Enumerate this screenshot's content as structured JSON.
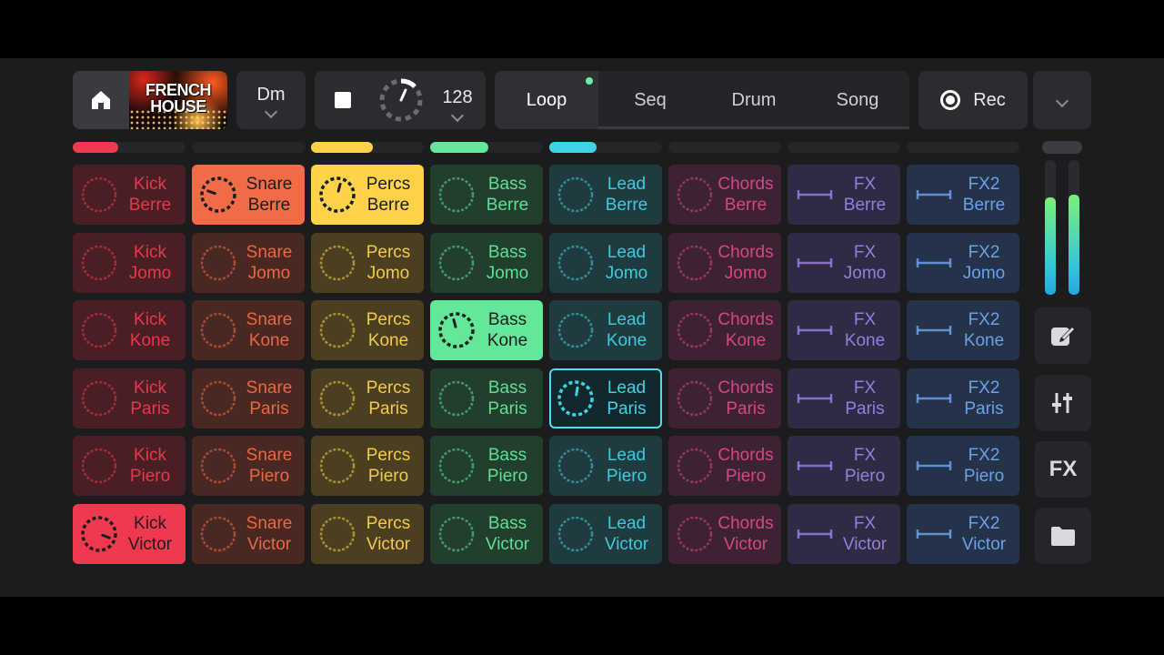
{
  "project": {
    "cover_title": "FRENCH\nHOUSE",
    "key": "Dm",
    "tempo": "128"
  },
  "icons": {
    "home": "home-icon",
    "stop": "stop-icon",
    "tempo_knob": "tempo-knob-icon",
    "record": "record-icon",
    "more": "chevron-down-icon",
    "edit": "edit-icon",
    "mixer": "mixer-sliders-icon",
    "folder": "folder-icon"
  },
  "tabs": [
    {
      "label": "Loop",
      "active": true
    },
    {
      "label": "Seq",
      "active": false
    },
    {
      "label": "Drum",
      "active": false
    },
    {
      "label": "Song",
      "active": false
    }
  ],
  "record": {
    "label": "Rec"
  },
  "sidebar": {
    "fx_label": "FX"
  },
  "levels": {
    "left": 0.72,
    "right": 0.74
  },
  "column_activity": [
    0.4,
    0,
    0.55,
    0.52,
    0.42,
    0,
    0,
    0
  ],
  "tracks": [
    {
      "name": "Kick",
      "color": "#f0394f",
      "tint": "#4a1f24",
      "active_row": 5,
      "type": "loop"
    },
    {
      "name": "Snare",
      "color": "#f26b47",
      "tint": "#4a2822",
      "active_row": 0,
      "type": "loop"
    },
    {
      "name": "Percs",
      "color": "#ffd24a",
      "tint": "#4a4021",
      "active_row": 0,
      "type": "loop"
    },
    {
      "name": "Bass",
      "color": "#63e79a",
      "tint": "#213f2c",
      "active_row": 2,
      "type": "loop"
    },
    {
      "name": "Lead",
      "color": "#3fd3e6",
      "tint": "#1f3b3f",
      "active_row": -1,
      "armed_row": 3,
      "type": "loop"
    },
    {
      "name": "Chords",
      "color": "#e0478e",
      "tint": "#3c2233",
      "active_row": -1,
      "type": "loop"
    },
    {
      "name": "FX",
      "color": "#9b82e6",
      "tint": "#302b45",
      "active_row": -1,
      "type": "fx"
    },
    {
      "name": "FX2",
      "color": "#6fa7f2",
      "tint": "#25334a",
      "active_row": -1,
      "type": "fx"
    }
  ],
  "scenes": [
    "Berre",
    "Jomo",
    "Kone",
    "Paris",
    "Piero",
    "Victor"
  ]
}
